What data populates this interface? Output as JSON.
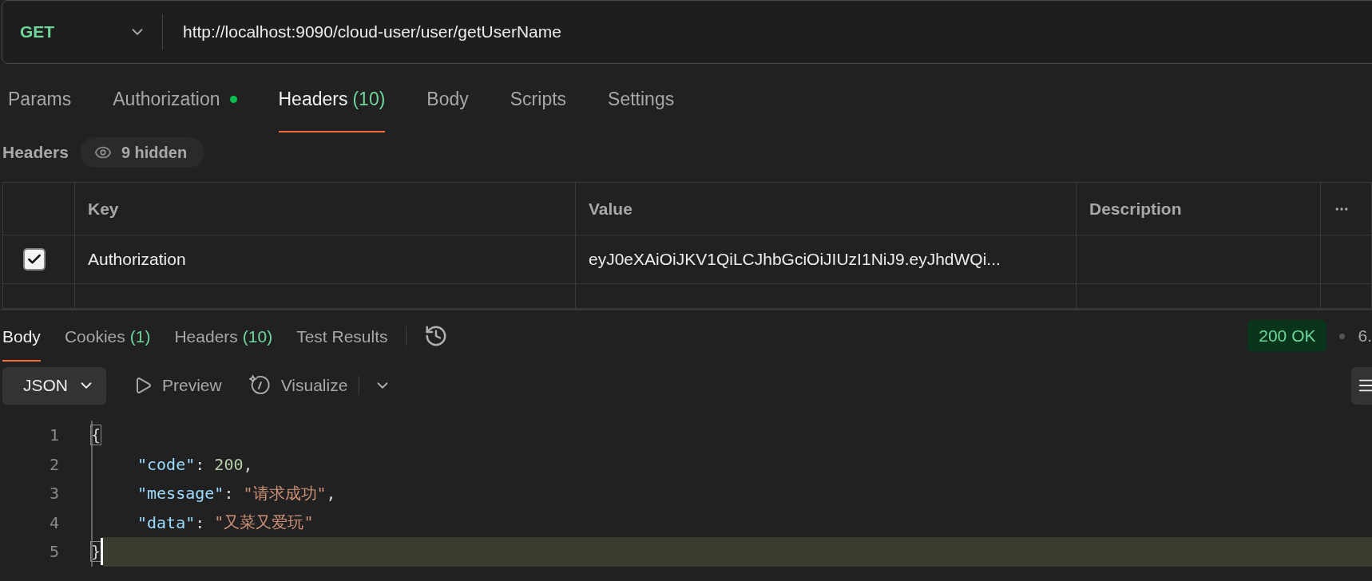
{
  "request": {
    "method": "GET",
    "url": "http://localhost:9090/cloud-user/user/getUserName"
  },
  "request_tabs": [
    {
      "label": "Params",
      "selected": false,
      "indicator": false
    },
    {
      "label": "Authorization",
      "selected": false,
      "indicator": true
    },
    {
      "label": "Headers",
      "count": "(10)",
      "selected": true,
      "indicator": false
    },
    {
      "label": "Body",
      "selected": false,
      "indicator": false
    },
    {
      "label": "Scripts",
      "selected": false,
      "indicator": false
    },
    {
      "label": "Settings",
      "selected": false,
      "indicator": false
    }
  ],
  "headers_section": {
    "title": "Headers",
    "hidden_toggle": "9 hidden"
  },
  "table": {
    "columns": [
      "Key",
      "Value",
      "Description"
    ],
    "rows": [
      {
        "checked": true,
        "key": "Authorization",
        "value": "eyJ0eXAiOiJKV1QiLCJhbGciOiJIUzI1NiJ9.eyJhdWQi..."
      }
    ]
  },
  "response": {
    "tabs": [
      {
        "label": "Body",
        "selected": true
      },
      {
        "label": "Cookies",
        "count": "(1)",
        "selected": false
      },
      {
        "label": "Headers",
        "count": "(10)",
        "selected": false
      },
      {
        "label": "Test Results",
        "selected": false
      }
    ],
    "status": "200 OK",
    "time": "6.",
    "toolbar": {
      "format": "JSON",
      "preview": "Preview",
      "visualize": "Visualize"
    },
    "lines": [
      {
        "number": "1",
        "indented": false,
        "selected": false,
        "tokens": [
          {
            "kind": "bracket",
            "text": "{"
          }
        ]
      },
      {
        "number": "2",
        "indented": true,
        "selected": false,
        "tokens": [
          {
            "kind": "key",
            "text": "\"code\""
          },
          {
            "kind": "punct",
            "text": ": "
          },
          {
            "kind": "number",
            "text": "200"
          },
          {
            "kind": "punct",
            "text": ","
          }
        ]
      },
      {
        "number": "3",
        "indented": true,
        "selected": false,
        "tokens": [
          {
            "kind": "key",
            "text": "\"message\""
          },
          {
            "kind": "punct",
            "text": ": "
          },
          {
            "kind": "string",
            "text": "\"请求成功\""
          },
          {
            "kind": "punct",
            "text": ","
          }
        ]
      },
      {
        "number": "4",
        "indented": true,
        "selected": false,
        "tokens": [
          {
            "kind": "key",
            "text": "\"data\""
          },
          {
            "kind": "punct",
            "text": ": "
          },
          {
            "kind": "string",
            "text": "\"又菜又爱玩\""
          }
        ]
      },
      {
        "number": "5",
        "indented": false,
        "selected": true,
        "tokens": [
          {
            "kind": "bracket",
            "text": "}"
          }
        ]
      }
    ]
  }
}
